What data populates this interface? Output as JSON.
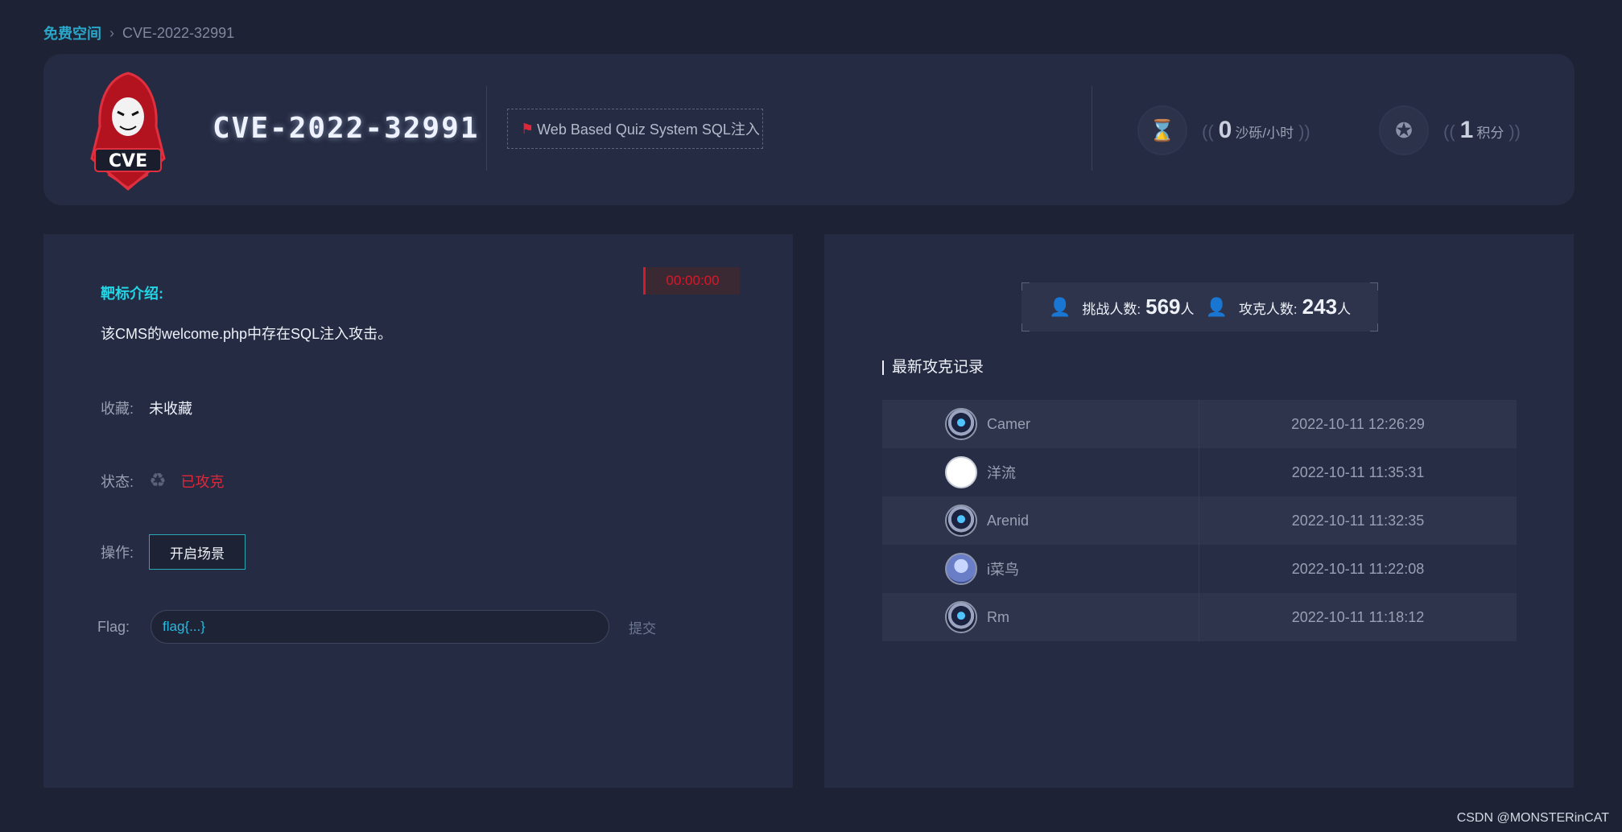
{
  "breadcrumb": {
    "home": "免费空间",
    "separator": "›",
    "current": "CVE-2022-32991"
  },
  "header": {
    "logo_text": "CVE",
    "title": "CVE-2022-32991",
    "tag": "Web Based Quiz System SQL注入",
    "stats": [
      {
        "icon": "hourglass-icon",
        "value": "0",
        "unit": "沙砾/小时"
      },
      {
        "icon": "medal-icon",
        "value": "1",
        "unit": "积分"
      }
    ]
  },
  "left": {
    "timer": "00:00:00",
    "intro_label": "靶标介绍:",
    "intro_text": "该CMS的welcome.php中存在SQL注入攻击。",
    "favorite_label": "收藏:",
    "favorite_value": "未收藏",
    "status_label": "状态:",
    "status_value": "已攻克",
    "action_label": "操作:",
    "action_button": "开启场景",
    "flag_label": "Flag:",
    "flag_placeholder": "flag{...}",
    "submit_label": "提交"
  },
  "right": {
    "challengers_label": "挑战人数:",
    "challengers_value": "569",
    "challengers_unit": "人",
    "solvers_label": "攻克人数:",
    "solvers_value": "243",
    "solvers_unit": "人",
    "records_title": "最新攻克记录",
    "records": [
      {
        "name": "Camer",
        "time": "2022-10-11 12:26:29"
      },
      {
        "name": "洋流",
        "time": "2022-10-11 11:35:31"
      },
      {
        "name": "Arenid",
        "time": "2022-10-11 11:32:35"
      },
      {
        "name": "i菜鸟",
        "time": "2022-10-11 11:22:08"
      },
      {
        "name": "Rm",
        "time": "2022-10-11 11:18:12"
      }
    ]
  },
  "watermark": "CSDN @MONSTERinCAT",
  "colors": {
    "accent_cyan": "#22d6e6",
    "danger_red": "#e0273a",
    "panel": "#252b42",
    "background": "#1d2235"
  }
}
